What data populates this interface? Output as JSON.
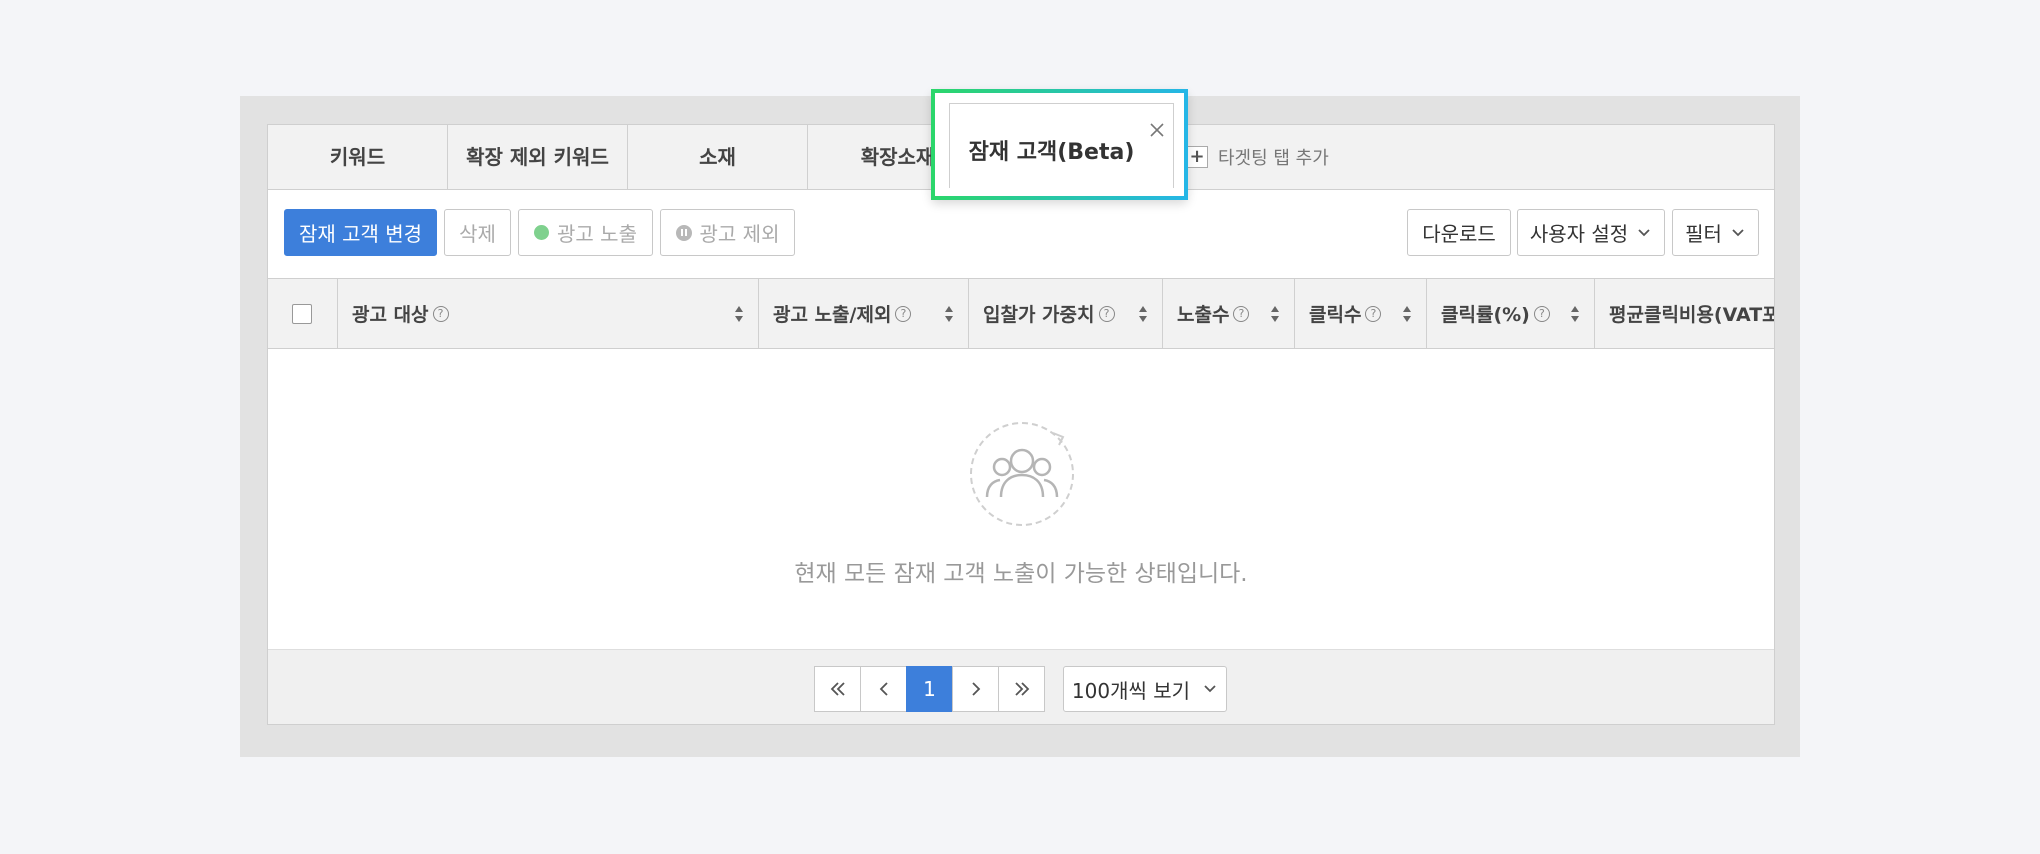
{
  "tabs": [
    {
      "label": "키워드"
    },
    {
      "label": "확장 제외 키워드"
    },
    {
      "label": "소재"
    },
    {
      "label": "확장소재"
    }
  ],
  "active_tab": {
    "label": "잠재 고객(Beta)"
  },
  "add_tab_label": "타겟팅 탭 추가",
  "toolbar": {
    "change_label": "잠재 고객 변경",
    "delete_label": "삭제",
    "expose_label": "광고 노출",
    "exclude_label": "광고 제외",
    "download_label": "다운로드",
    "user_settings_label": "사용자 설정",
    "filter_label": "필터"
  },
  "columns": [
    {
      "label": "광고 대상"
    },
    {
      "label": "광고 노출/제외"
    },
    {
      "label": "입찰가 가중치"
    },
    {
      "label": "노출수"
    },
    {
      "label": "클릭수"
    },
    {
      "label": "클릭률(%)"
    },
    {
      "label": "평균클릭비용(VAT포함"
    }
  ],
  "empty_message": "현재 모든 잠재 고객 노출이 가능한 상태입니다.",
  "pagination": {
    "current_page": "1",
    "per_page_label": "100개씩 보기"
  },
  "colors": {
    "primary": "#3d7fdb",
    "highlight_start": "#2bd66b",
    "highlight_end": "#25b6e6",
    "expose_dot": "#7fd18e"
  }
}
